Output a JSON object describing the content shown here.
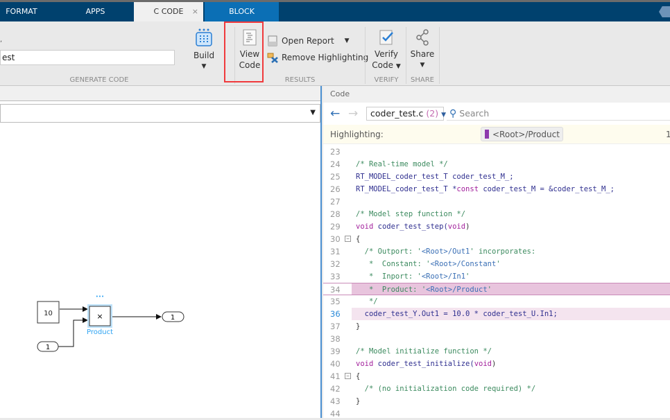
{
  "tabs": [
    {
      "label": "FORMAT"
    },
    {
      "label": "APPS"
    },
    {
      "label": "C CODE",
      "active": true
    },
    {
      "label": "BLOCK"
    }
  ],
  "ribbon": {
    "model_field": "est",
    "build_label": "Build",
    "generate_group": "GENERATE CODE",
    "view_code": [
      "View",
      "Code"
    ],
    "open_report": "Open Report",
    "remove_highlighting": "Remove Highlighting",
    "results_group": "RESULTS",
    "verify_code": [
      "Verify",
      "Code"
    ],
    "verify_group": "VERIFY",
    "share_label": "Share",
    "share_group": "SHARE"
  },
  "diagram": {
    "constant": "10",
    "inport": "1",
    "outport": "1",
    "product_label": "Product",
    "product_symbol": "×",
    "selection_dots": "•••"
  },
  "code": {
    "panel_title": "Code",
    "file": "coder_test.c",
    "file_count": "(2)",
    "search_placeholder": "Search",
    "highlighting_label": "Highlighting:",
    "highlight_chip": "<Root>/Product",
    "highlight_count": "1",
    "current_line": 36,
    "lines": [
      {
        "n": "23",
        "t": []
      },
      {
        "n": "24",
        "t": [
          [
            "c",
            "/* Real-time model */"
          ]
        ]
      },
      {
        "n": "25",
        "t": [
          [
            "i",
            "RT_MODEL_coder_test_T coder_test_M_;"
          ]
        ]
      },
      {
        "n": "26",
        "t": [
          [
            "i",
            "RT_MODEL_coder_test_T *"
          ],
          [
            "k",
            "const"
          ],
          [
            "i",
            " coder_test_M = &coder_test_M_;"
          ]
        ]
      },
      {
        "n": "27",
        "t": []
      },
      {
        "n": "28",
        "t": [
          [
            "c",
            "/* Model step function */"
          ]
        ]
      },
      {
        "n": "29",
        "t": [
          [
            "k",
            "void"
          ],
          [
            "i",
            " coder_test_step("
          ],
          [
            "k",
            "void"
          ],
          [
            "p",
            ")"
          ]
        ]
      },
      {
        "n": "30",
        "fold": true,
        "t": [
          [
            "p",
            "{"
          ]
        ]
      },
      {
        "n": "31",
        "t": [
          [
            "c",
            "  /* Outport: '"
          ],
          [
            "s",
            "<Root>/Out1"
          ],
          [
            "c",
            "' incorporates:"
          ]
        ]
      },
      {
        "n": "32",
        "t": [
          [
            "c",
            "   *  Constant: '"
          ],
          [
            "s",
            "<Root>/Constant"
          ],
          [
            "c",
            "'"
          ]
        ]
      },
      {
        "n": "33",
        "t": [
          [
            "c",
            "   *  Inport: '"
          ],
          [
            "s",
            "<Root>/In1"
          ],
          [
            "c",
            "'"
          ]
        ]
      },
      {
        "n": "34",
        "hl": "strong",
        "t": [
          [
            "c",
            "   *  Product: '"
          ],
          [
            "s",
            "<Root>/Product"
          ],
          [
            "c",
            "'"
          ]
        ]
      },
      {
        "n": "35",
        "t": [
          [
            "c",
            "   */"
          ]
        ]
      },
      {
        "n": "36",
        "hl": "light",
        "t": [
          [
            "i",
            "  coder_test_Y.Out1 = 10.0 * coder_test_U.In1;"
          ]
        ]
      },
      {
        "n": "37",
        "t": [
          [
            "p",
            "}"
          ]
        ]
      },
      {
        "n": "38",
        "t": []
      },
      {
        "n": "39",
        "t": [
          [
            "c",
            "/* Model initialize function */"
          ]
        ]
      },
      {
        "n": "40",
        "t": [
          [
            "k",
            "void"
          ],
          [
            "i",
            " coder_test_initialize("
          ],
          [
            "k",
            "void"
          ],
          [
            "p",
            ")"
          ]
        ]
      },
      {
        "n": "41",
        "fold": true,
        "t": [
          [
            "p",
            "{"
          ]
        ]
      },
      {
        "n": "42",
        "t": [
          [
            "c",
            "  /* (no initialization code required) */"
          ]
        ]
      },
      {
        "n": "43",
        "t": [
          [
            "p",
            "}"
          ]
        ]
      },
      {
        "n": "44",
        "t": []
      }
    ]
  },
  "colors": {
    "tabbar": "#00416e",
    "block_tab": "#0b6fb5",
    "highlight_box": "#f0393c",
    "selection": "#2ea3f2"
  }
}
